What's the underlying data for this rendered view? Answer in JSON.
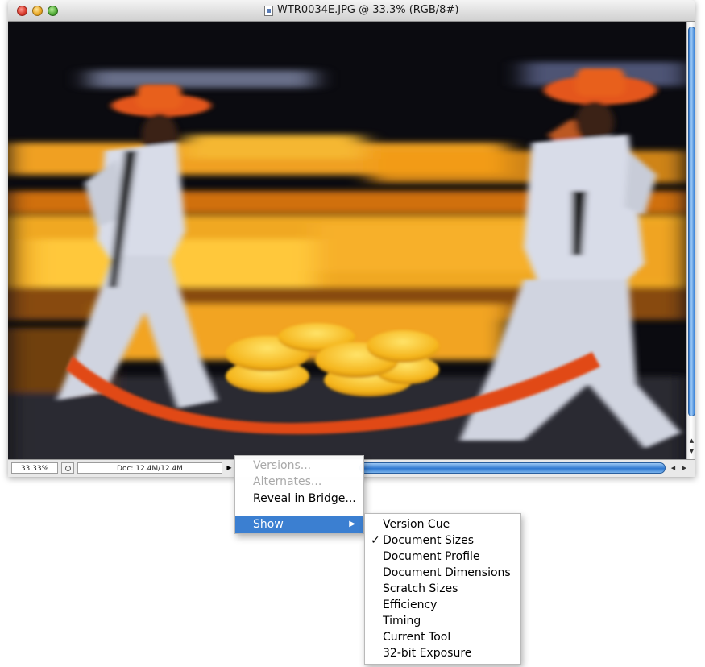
{
  "window": {
    "title": "WTR0034E.JPG @ 33.3% (RGB/8#)"
  },
  "canvas": {
    "photo_subject": "Two men in orange hats carrying a wooden sled of yellow cheese wheels (motion-blurred photo)"
  },
  "status_bar": {
    "zoom": "33.33%",
    "doc_info": "Doc: 12.4M/12.4M"
  },
  "status_menu": {
    "items": [
      {
        "label": "Versions...",
        "enabled": false
      },
      {
        "label": "Alternates...",
        "enabled": false
      },
      {
        "label": "Reveal in Bridge...",
        "enabled": true
      },
      {
        "label": "Show",
        "enabled": true,
        "highlighted": true,
        "submenu": true
      }
    ]
  },
  "show_submenu": {
    "items": [
      {
        "label": "Version Cue",
        "checked": false
      },
      {
        "label": "Document Sizes",
        "checked": true
      },
      {
        "label": "Document Profile",
        "checked": false
      },
      {
        "label": "Document Dimensions",
        "checked": false
      },
      {
        "label": "Scratch Sizes",
        "checked": false
      },
      {
        "label": "Efficiency",
        "checked": false
      },
      {
        "label": "Timing",
        "checked": false
      },
      {
        "label": "Current Tool",
        "checked": false
      },
      {
        "label": "32-bit Exposure",
        "checked": false
      }
    ],
    "check_glyph": "✓"
  },
  "colors": {
    "menu_highlight": "#3b7fd1",
    "scroll_blue": "#2f78d0"
  }
}
